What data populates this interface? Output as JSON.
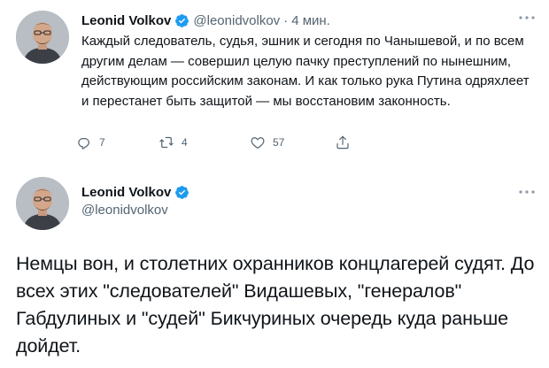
{
  "tweet1": {
    "author_name": "Leonid Volkov",
    "handle": "@leonidvolkov",
    "separator": "·",
    "time": "4 мин.",
    "text": "Каждый следователь, судья, эшник и сегодня по Чанышевой, и по всем другим делам — совершил целую пачку преступлений по нынешним, действующим российским законам. И как только рука Путина одряхлеет и перестанет быть защитой — мы восстановим законность.",
    "actions": {
      "reply_count": "7",
      "retweet_count": "4",
      "like_count": "57"
    }
  },
  "tweet2": {
    "author_name": "Leonid Volkov",
    "handle": "@leonidvolkov",
    "text": "Немцы вон, и столетних охранников концлагерей судят. До всех этих \"следователей\" Видашевых, \"генералов\" Габдулиных и \"судей\" Бикчуриных очередь куда раньше дойдет."
  },
  "colors": {
    "text": "#0f1419",
    "secondary": "#536471",
    "verified": "#1d9bf0"
  },
  "icons": [
    "verified-badge-icon",
    "more-options-icon",
    "reply-icon",
    "retweet-icon",
    "like-icon",
    "share-icon"
  ]
}
